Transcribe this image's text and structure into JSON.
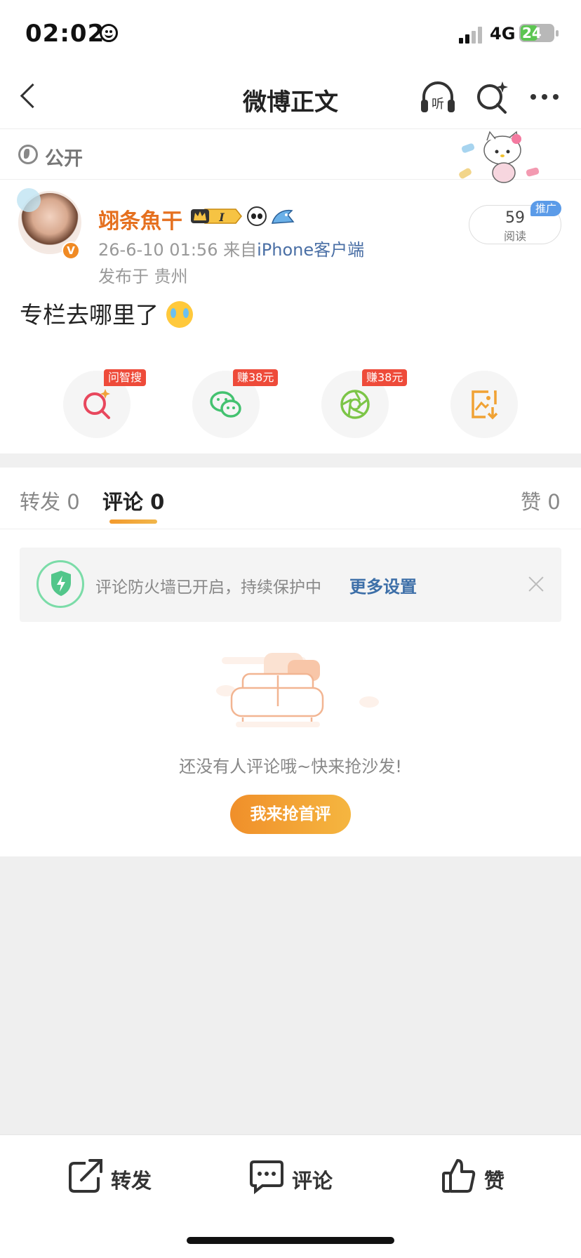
{
  "status_bar": {
    "time": "02:02",
    "network": "4G",
    "battery": "24"
  },
  "nav": {
    "title": "微博正文"
  },
  "visibility": {
    "label": "公开"
  },
  "author": {
    "name": "翊条魚干",
    "meta_time": "26-6-10 01:56",
    "meta_from_prefix": "来自",
    "meta_source": "iPhone客户端",
    "location": "发布于 贵州",
    "reads_count": "59",
    "reads_label": "阅读",
    "promo_badge": "推广"
  },
  "post": {
    "text": "专栏去哪里了"
  },
  "share_tags": {
    "search": "问智搜",
    "wechat": "赚38元",
    "moments": "赚38元"
  },
  "tabs": [
    {
      "label": "转发",
      "count": "0"
    },
    {
      "label": "评论",
      "count": "0"
    },
    {
      "label": "赞",
      "count": "0"
    }
  ],
  "firewall": {
    "text": "评论防火墙已开启，持续保护中",
    "link": "更多设置"
  },
  "empty_state": {
    "text": "还没有人评论哦~快来抢沙发!",
    "button": "我来抢首评"
  },
  "actions": {
    "repost": "转发",
    "comment": "评论",
    "like": "赞"
  },
  "colors": {
    "accent_orange": "#e5701f",
    "link_blue": "#3d6fa8",
    "tag_red": "#ee4b3a",
    "shield_green": "#52c68a"
  }
}
